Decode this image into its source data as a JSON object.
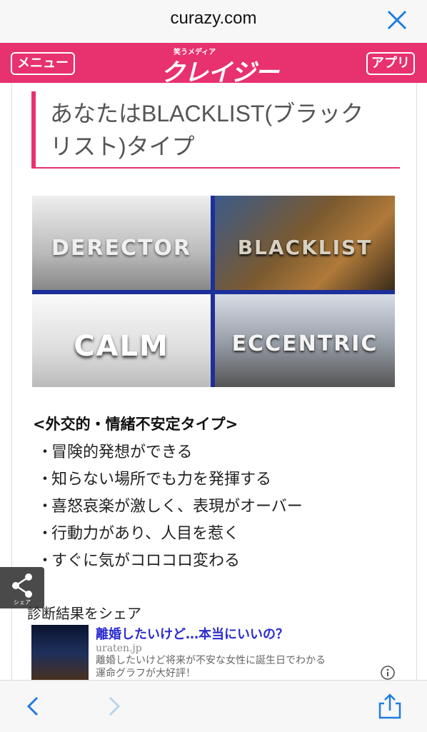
{
  "browser": {
    "url": "curazy.com",
    "close_icon": "close-icon"
  },
  "header": {
    "menu_label": "メニュー",
    "app_label": "アプリ",
    "logo_small": "笑うメディア",
    "logo_big": "クレイジー",
    "accent": "#e8316f"
  },
  "article": {
    "title": "あなたはBLACKLIST(ブラックリスト)タイプ",
    "tiles": [
      "DERECTOR",
      "BLACKLIST",
      "CALM",
      "ECCENTRIC"
    ],
    "type_heading": "<外交的・情緒不安定タイプ>",
    "traits": [
      "冒険的発想ができる",
      "知らない場所でも力を発揮する",
      "喜怒哀楽が激しく、表現がオーバー",
      "行動力があり、人目を惹く",
      "すぐに気がコロコロ変わる"
    ],
    "bullet": "・",
    "share_caption": "シェア",
    "share_text": "診断結果をシェア"
  },
  "ad": {
    "title": "離婚したいけど…本当にいいの？",
    "domain": "uraten.jp",
    "description": "離婚したいけど将来が不安な女性に誕生日でわかる運命グラフが大好評！"
  },
  "toolbar": {
    "back_icon": "chevron-left-icon",
    "forward_icon": "chevron-right-icon",
    "share_icon": "share-upload-icon"
  }
}
